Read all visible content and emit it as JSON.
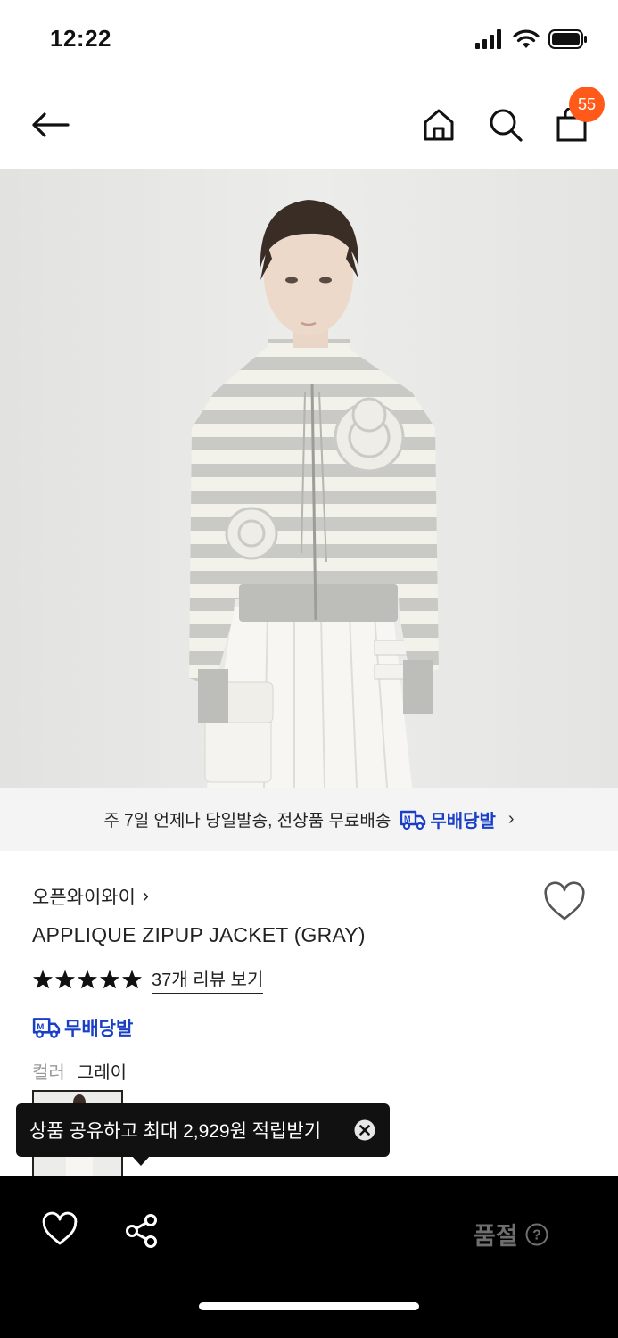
{
  "status_bar": {
    "time": "12:22"
  },
  "nav": {
    "cart_count": "55"
  },
  "shipping_banner": {
    "text": "주 7일 언제나 당일발송, 전상품 무료배송",
    "logo_text": "무배당발",
    "chevron": "›"
  },
  "product": {
    "brand": "오픈와이와이",
    "brand_chevron": "›",
    "title": "APPLIQUE ZIPUP JACKET (GRAY)",
    "rating_stars": 5,
    "review_link": "37개 리뷰 보기",
    "free_shipping_badge": "무배당발",
    "color_label": "컬러",
    "color_value": "그레이"
  },
  "tooltip": {
    "text": "상품 공유하고 최대 2,929원 적립받기"
  },
  "bottom_bar": {
    "status": "품절",
    "help": "?"
  },
  "colors": {
    "accent_blue": "#1a3fc7",
    "badge_orange": "#ff5a1a",
    "bottom_bar_bg": "#000000",
    "soldout_text": "#6f6f6f"
  }
}
